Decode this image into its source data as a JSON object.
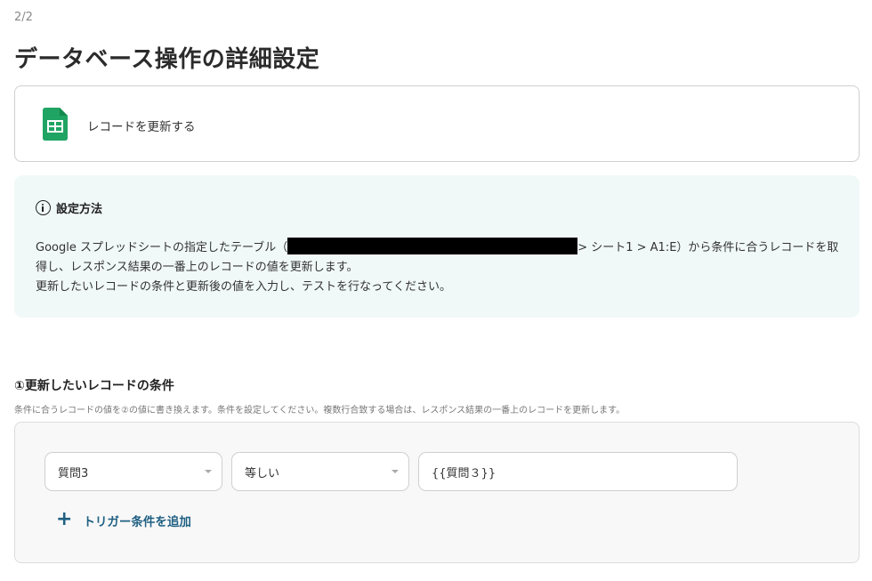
{
  "header": {
    "step": "2/2",
    "title": "データベース操作の詳細設定"
  },
  "action": {
    "icon": "google-sheets-icon",
    "label": "レコードを更新する"
  },
  "info": {
    "icon": "info-icon",
    "title": "設定方法",
    "line1_a": "Google スプレッドシートの指定したテーブル（",
    "line1_b": "> シート1 > A1:E）から条件に合うレコードを取得し、レスポンス結果の一番上のレコードの値を更新します。",
    "line2": "更新したいレコードの条件と更新後の値を入力し、テストを行なってください。"
  },
  "condition_section": {
    "title": "①更新したいレコードの条件",
    "description": "条件に合うレコードの値を②の値に書き換えます。条件を設定してください。複数行合致する場合は、レスポンス結果の一番上のレコードを更新します。",
    "field_select": "質問3",
    "operator_select": "等しい",
    "value_input": "{{質問３}}",
    "add_label": "トリガー条件を追加",
    "add_icon": "plus-icon"
  },
  "colors": {
    "sheets_green": "#1fa463",
    "info_bg": "#f1f8f8",
    "link": "#1f5f82"
  }
}
